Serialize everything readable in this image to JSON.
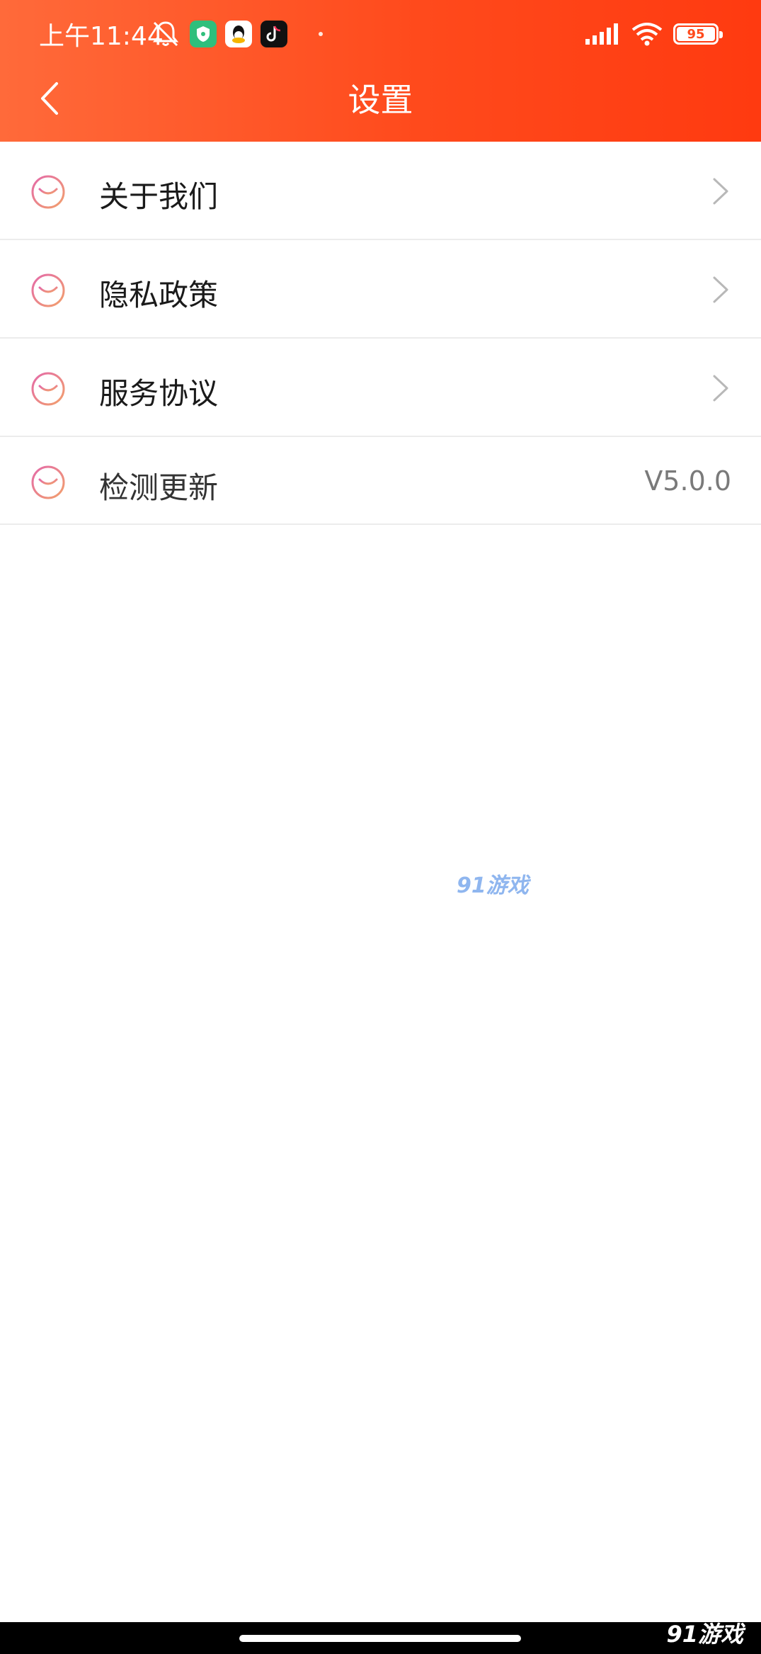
{
  "status_bar": {
    "time": "上午11:44",
    "battery": "95"
  },
  "header": {
    "title": "设置"
  },
  "settings": {
    "items": [
      {
        "label": "关于我们"
      },
      {
        "label": "隐私政策"
      },
      {
        "label": "服务协议"
      },
      {
        "label": "检测更新",
        "value": "V5.0.0"
      }
    ]
  },
  "watermark": {
    "center": "91游戏",
    "corner": "91游戏"
  },
  "colors": {
    "header_start": "#ff6a3a",
    "header_end": "#ff3a10",
    "icon_pink": "#e06aa0",
    "icon_orange": "#f0a070"
  },
  "icons": {
    "back": "chevron-left-icon",
    "item": "smile-face-icon",
    "row_arrow": "chevron-right-icon"
  }
}
